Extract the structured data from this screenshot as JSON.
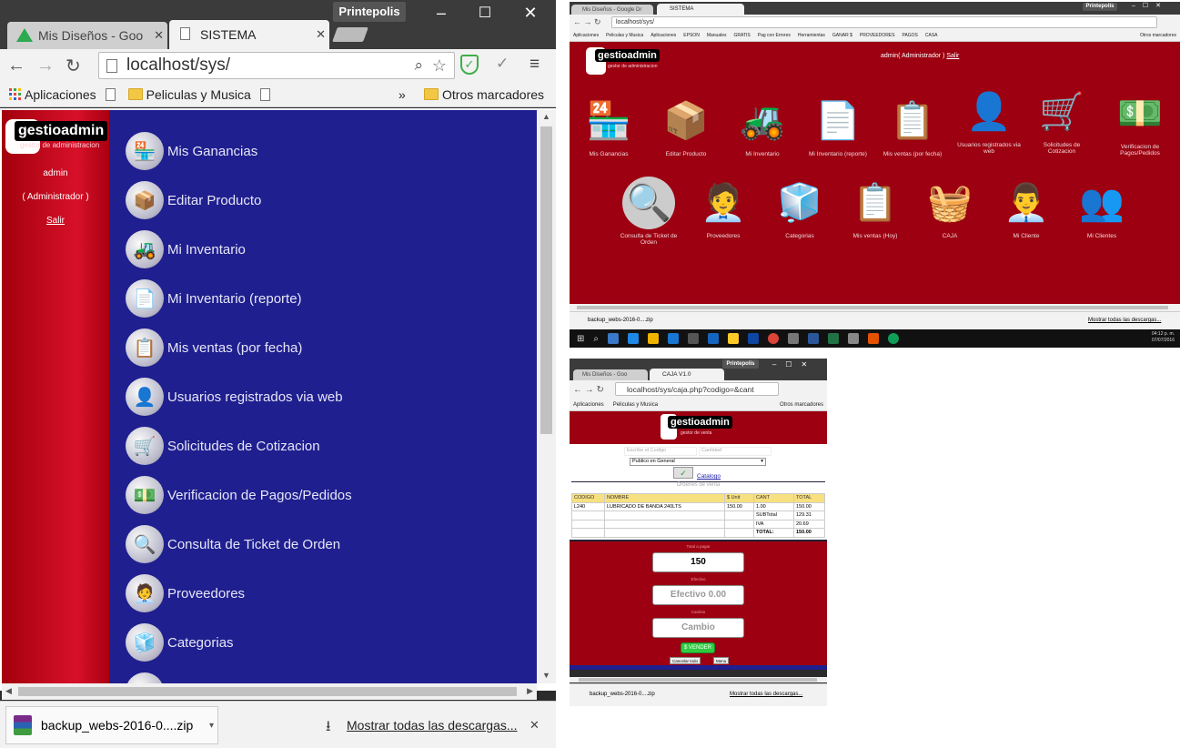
{
  "win1": {
    "tabs": [
      {
        "label": "Mis Diseños - Goo",
        "close": "✕"
      },
      {
        "label": "SISTEMA",
        "close": "✕"
      }
    ],
    "profile": "Printepolis",
    "url": "localhost/sys/",
    "bookmarks": [
      "Aplicaciones",
      "Peliculas y Musica"
    ],
    "bookmarks_more": "»",
    "other_bookmarks": "Otros marcadores",
    "user": {
      "name": "admin",
      "role": "( Administrador )",
      "logout": "Salir"
    },
    "logo": {
      "title": "gestioadmin",
      "subtitle": "gestor de administracion"
    },
    "menu": [
      "Mis Ganancias",
      "Editar Producto",
      "Mi Inventario",
      "Mi Inventario (reporte)",
      "Mis ventas (por fecha)",
      "Usuarios registrados via web",
      "Solicitudes de Cotizacion",
      "Verificacion de Pagos/Pedidos",
      "Consulta de Ticket de Orden",
      "Proveedores",
      "Categorias"
    ],
    "download": {
      "file": "backup_webs-2016-0....zip",
      "show_all": "Mostrar todas las descargas...",
      "close": "✕"
    }
  },
  "win2": {
    "tabs": [
      {
        "label": "Mis Diseños - Google Dr"
      },
      {
        "label": "SISTEMA"
      }
    ],
    "profile": "Printepolis",
    "url": "localhost/sys/",
    "bookmarks": [
      "Aplicaciones",
      "Peliculas y Musica",
      "Aplicaciones",
      "EPSON",
      "Manuales",
      "GRATIS",
      "Pag con Errores",
      "Herramientas",
      "GANAR $",
      "PROVEEDORES",
      "PAGOS",
      "CASA"
    ],
    "other_bookmarks": "Otros marcadores",
    "logo": {
      "title": "gestioadmin",
      "subtitle": "gestor de administracion"
    },
    "user_line": "admin( Administrador )",
    "logout": "Salir",
    "grid_row1": [
      "Mis Ganancias",
      "Editar Producto",
      "Mi Inventario",
      "Mi Inventario (reporte)",
      "Mis ventas (por fecha)",
      "Usuarios registrados via web",
      "Solicitudes de Cotizacion",
      "Verificacion de Pagos/Pedidos"
    ],
    "grid_row2": [
      "Consulta de Ticket de Orden",
      "Proveedores",
      "Categorias",
      "Mis ventas (Hoy)",
      "CAJA",
      "Mi Cliente",
      "Mi Clientes"
    ],
    "download": {
      "file": "backup_webs-2016-0....zip",
      "show_all": "Mostrar todas las descargas..."
    },
    "clock": {
      "time": "04:12 p. m.",
      "date": "07/07/2016"
    }
  },
  "win3": {
    "tabs": [
      {
        "label": "Mis Diseños - Goo"
      },
      {
        "label": "CAJA V1.0"
      }
    ],
    "profile": "Printepolis",
    "url": "localhost/sys/caja.php?codigo=&cant",
    "bookmarks": [
      "Aplicaciones",
      "Peliculas y Musica"
    ],
    "other_bookmarks": "Otros marcadores",
    "logo": {
      "title": "gestioadmin",
      "subtitle": "gestor de venta"
    },
    "code_placeholder": "Escribe el Codigo",
    "qty_placeholder": "Cantidad",
    "client_select": "Publico en General",
    "catalog_link": "Catalogo",
    "orders_title": "Ordenes de venta",
    "table_headers": [
      "CODIGO",
      "NOMBRE",
      "$ Unit",
      "CANT",
      "TOTAL"
    ],
    "rows": [
      [
        "L240",
        "LUBRICADO DE BANDA 240LTS",
        "150.00",
        "1.00",
        "150.00"
      ],
      [
        "",
        "",
        "",
        "SUBTotal",
        "129.31"
      ],
      [
        "",
        "",
        "",
        "IVA",
        "20.69"
      ],
      [
        "",
        "",
        "",
        "TOTAL:",
        "150.00"
      ]
    ],
    "total_label": "Total a pagar",
    "total_value": "150",
    "cash_label": "Efectivo",
    "cash_placeholder": "Efectivo 0.00",
    "change_label": "Cambio",
    "change_placeholder": "Cambio",
    "sell_button": "$ VENDER",
    "cancel_button": "Cancelar todo",
    "menu_button": "Menu",
    "download": {
      "file": "backup_webs-2016-0....zip",
      "show_all": "Mostrar todas las descargas..."
    }
  }
}
